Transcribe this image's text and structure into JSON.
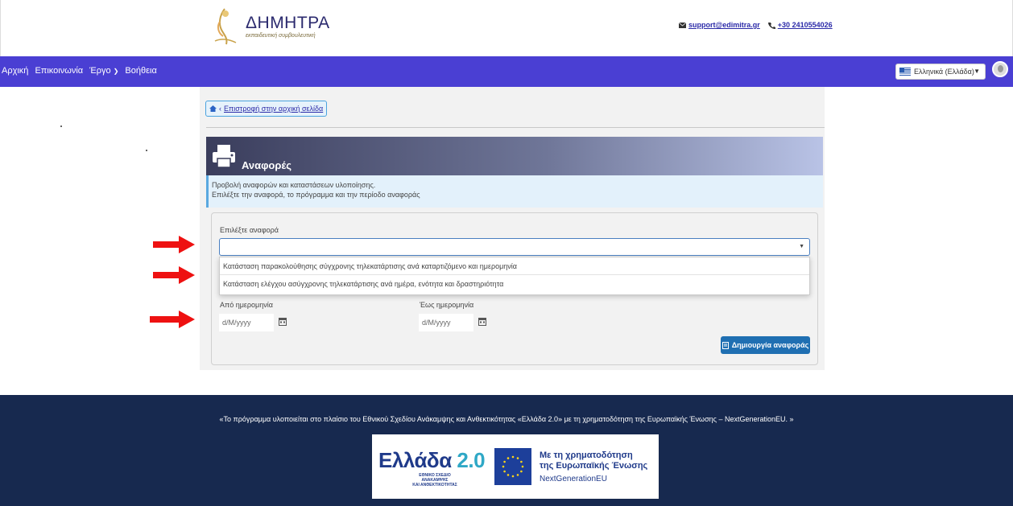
{
  "header": {
    "logo_title": "ΔΗΜΗΤΡΑ",
    "logo_subtitle": "εκπαιδευτική συμβουλευτική",
    "email": "support@edimitra.gr",
    "phone": "+30 2410554026"
  },
  "nav": {
    "items": [
      "Αρχική",
      "Επικοινωνία",
      "Έργο",
      "Βοήθεια"
    ],
    "language": "Ελληνικά (Ελλάδα)"
  },
  "page": {
    "back_label": "Επιστροφή στην αρχική σελίδα",
    "title": "Αναφορές",
    "info_line1": "Προβολή αναφορών και καταστάσεων υλοποίησης.",
    "info_line2": "Επιλέξτε την αναφορά, το πρόγραμμα και την περίοδο αναφοράς"
  },
  "form": {
    "report_label": "Επιλέξτε αναφορά",
    "report_value": "",
    "dropdown_options": [
      "Κατάσταση παρακολούθησης σύγχρονης τηλεκατάρτισης ανά καταρτιζόμενο και ημερομηνία",
      "Κατάσταση ελέγχου ασύγχρονης τηλεκατάρτισης ανά ημέρα, ενότητα και δραστηριότητα"
    ],
    "from_label": "Από ημερομηνία",
    "from_placeholder": "d/M/yyyy",
    "to_label": "Έως ημερομηνία",
    "to_placeholder": "d/M/yyyy",
    "create_button": "Δημιουργία αναφοράς"
  },
  "footer": {
    "text": "«Το πρόγραμμα υλοποιείται στο πλαίσιο του Εθνικού Σχεδίου Ανάκαμψης και Ανθεκτικότητας «Ελλάδα 2.0» με τη χρηματοδότηση της Ευρωπαϊκής Ένωσης – NextGenerationEU. »",
    "greece_logo_word": "Ελλάδα",
    "greece_logo_num": "2.0",
    "greece_logo_sub1": "ΕΘΝΙΚΟ ΣΧΕΔΙΟ ΑΝΑΚΑΜΨΗΣ",
    "greece_logo_sub2": "ΚΑΙ ΑΝΘΕΚΤΙΚΟΤΗΤΑΣ",
    "eu_line1": "Με τη χρηματοδότηση",
    "eu_line2": "της Ευρωπαϊκής Ένωσης",
    "eu_line3": "NextGenerationEU"
  },
  "colors": {
    "navbar": "#4a3fd3",
    "footer": "#17294f",
    "button": "#1f6fb2",
    "arrows": "#ee1111"
  }
}
